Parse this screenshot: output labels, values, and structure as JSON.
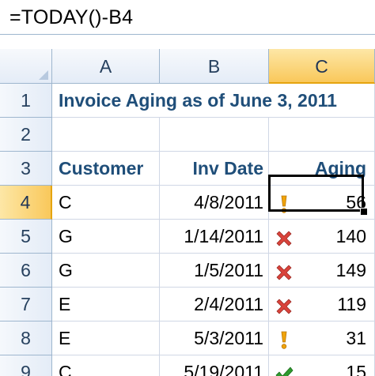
{
  "formula_bar": {
    "formula": "=TODAY()-B4"
  },
  "columns": [
    "A",
    "B",
    "C"
  ],
  "selected_column": "C",
  "rows": [
    {
      "num": "1",
      "a": "Invoice Aging as of June 3, 2011",
      "b": "",
      "c": "",
      "icon": ""
    },
    {
      "num": "2",
      "a": "",
      "b": "",
      "c": "",
      "icon": ""
    },
    {
      "num": "3",
      "a": "Customer",
      "b": "Inv Date",
      "c": "Aging",
      "icon": ""
    },
    {
      "num": "4",
      "a": "C",
      "b": "4/8/2011",
      "c": "56",
      "icon": "exclamation-icon"
    },
    {
      "num": "5",
      "a": "G",
      "b": "1/14/2011",
      "c": "140",
      "icon": "red-x-icon"
    },
    {
      "num": "6",
      "a": "G",
      "b": "1/5/2011",
      "c": "149",
      "icon": "red-x-icon"
    },
    {
      "num": "7",
      "a": "E",
      "b": "2/4/2011",
      "c": "119",
      "icon": "red-x-icon"
    },
    {
      "num": "8",
      "a": "E",
      "b": "5/3/2011",
      "c": "31",
      "icon": "exclamation-icon"
    },
    {
      "num": "9",
      "a": "C",
      "b": "5/19/2011",
      "c": "15",
      "icon": "green-check-icon"
    }
  ],
  "selected_row": "4",
  "colors": {
    "header_text": "#1f4e79",
    "selected_header": "#f9c85b",
    "red_x": "#d9433b",
    "exclamation": "#f0a30a",
    "check": "#2e9a2e"
  }
}
